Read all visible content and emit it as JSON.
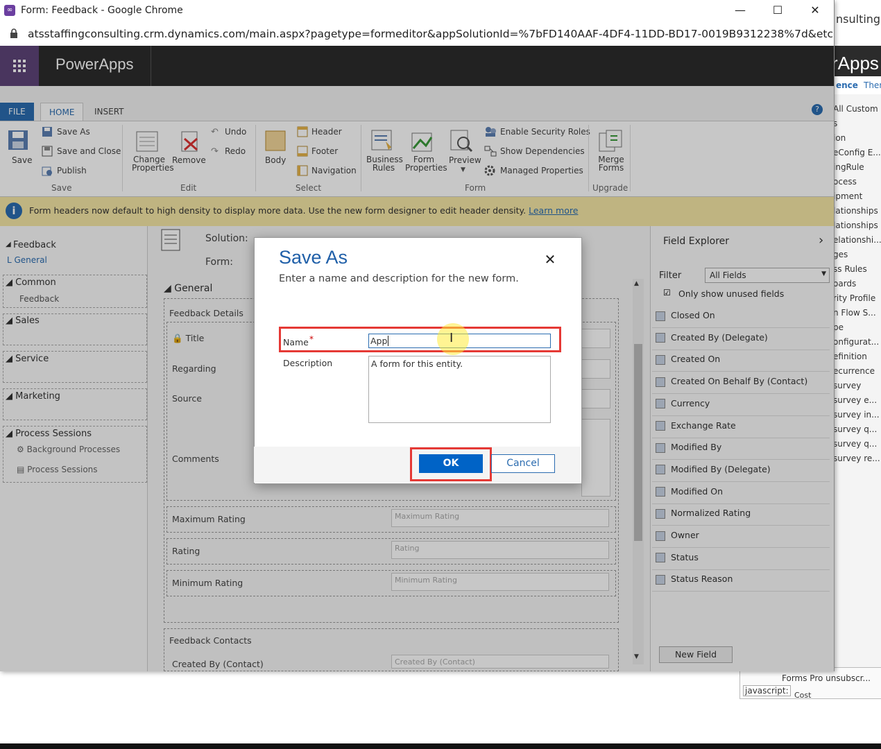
{
  "window": {
    "title": "Form: Feedback - Google Chrome",
    "url": "atsstaffingconsulting.crm.dynamics.com/main.aspx?pagetype=formeditor&appSolutionId=%7bFD140AAF-4DF4-11DD-BD17-0019B9312238%7d&etc=9958...",
    "minimize": "—",
    "maximize": "☐",
    "close": "✕"
  },
  "appbar": {
    "waffle": "⋮⋮⋮",
    "name": "PowerApps"
  },
  "ribbon": {
    "tabs": [
      "FILE",
      "HOME",
      "INSERT"
    ],
    "help": "?",
    "save": "Save",
    "save_as": "Save As",
    "save_and_close": "Save and Close",
    "publish": "Publish",
    "group_save": "Save",
    "change_properties": "Change Properties",
    "remove": "Remove",
    "undo": "Undo",
    "redo": "Redo",
    "group_edit": "Edit",
    "body": "Body",
    "header": "Header",
    "footer": "Footer",
    "navigation": "Navigation",
    "group_select": "Select",
    "business_rules": "Business Rules",
    "form_properties": "Form Properties",
    "preview": "Preview",
    "enable_security_roles": "Enable Security Roles",
    "show_dependencies": "Show Dependencies",
    "managed_properties": "Managed Properties",
    "group_form": "Form",
    "merge_forms": "Merge Forms",
    "group_upgrade": "Upgrade"
  },
  "infobar": {
    "icon": "i",
    "text": "Form headers now default to high density to display more data. Use the new form designer to edit header density.",
    "link": "Learn more"
  },
  "leftnav": {
    "feedback": "Feedback",
    "general": "General",
    "common": "Common",
    "common_feedback": "Feedback",
    "sales": "Sales",
    "service": "Service",
    "marketing": "Marketing",
    "process_sessions": "Process Sessions",
    "background_processes": "Background Processes",
    "process_sessions_item": "Process Sessions"
  },
  "canvas": {
    "solution_label": "Solution:",
    "form_label": "Form:",
    "general_tab": "General",
    "section_feedback_details": "Feedback Details",
    "title": "Title",
    "regarding": "Regarding",
    "source": "Source",
    "comments": "Comments",
    "maximum_rating": "Maximum Rating",
    "maximum_rating_ph": "Maximum Rating",
    "rating": "Rating",
    "rating_ph": "Rating",
    "minimum_rating": "Minimum Rating",
    "minimum_rating_ph": "Minimum Rating",
    "section_feedback_contacts": "Feedback Contacts",
    "created_by_contact": "Created By (Contact)",
    "created_by_contact_ph": "Created By (Contact)"
  },
  "explorer": {
    "title": "Field Explorer",
    "chevron": "›",
    "filter_label": "Filter",
    "filter_value": "All Fields",
    "only_unused": "Only show unused fields",
    "fields": [
      "Closed On",
      "Created By (Delegate)",
      "Created On",
      "Created On Behalf By (Contact)",
      "Currency",
      "Exchange Rate",
      "Modified By",
      "Modified By (Delegate)",
      "Modified On",
      "Normalized Rating",
      "Owner",
      "Status",
      "Status Reason"
    ],
    "new_field": "New Field"
  },
  "modal": {
    "title": "Save As",
    "subtitle": "Enter a name and description for the new form.",
    "close": "✕",
    "name_label": "Name",
    "required": "*",
    "name_value": "App",
    "description_label": "Description",
    "description_value": "A form for this entity.",
    "ok": "OK",
    "cancel": "Cancel"
  },
  "background_window": {
    "url_fragment": "nsulting.c",
    "app_fragment": "rApps",
    "tab_fragment_1": "ence",
    "tab_fragment_2": "Ther",
    "list": [
      "All Custom",
      "s",
      "ion",
      "eConfig E...",
      "ingRule",
      "ocess",
      "ipment",
      "lationships",
      "lationships",
      "elationshi...",
      "ges",
      "ss Rules",
      "oards",
      "rity Profile",
      "n Flow S...",
      "pe",
      "onfigurat...",
      "efinition",
      "ecurrence",
      "survey",
      "survey e...",
      "survey in...",
      "survey q...",
      "survey q...",
      "survey re..."
    ],
    "forms_pro": "Forms Pro unsubscr...",
    "js_status": "javascript:",
    "cut_text": "Cost"
  },
  "colors": {
    "accent": "#2b6cb0",
    "ok_button": "#0063c6",
    "highlight": "#e53935",
    "appbar": "#2c2c2c",
    "waffle": "#5e4479",
    "infobar": "#f5e7a6"
  }
}
